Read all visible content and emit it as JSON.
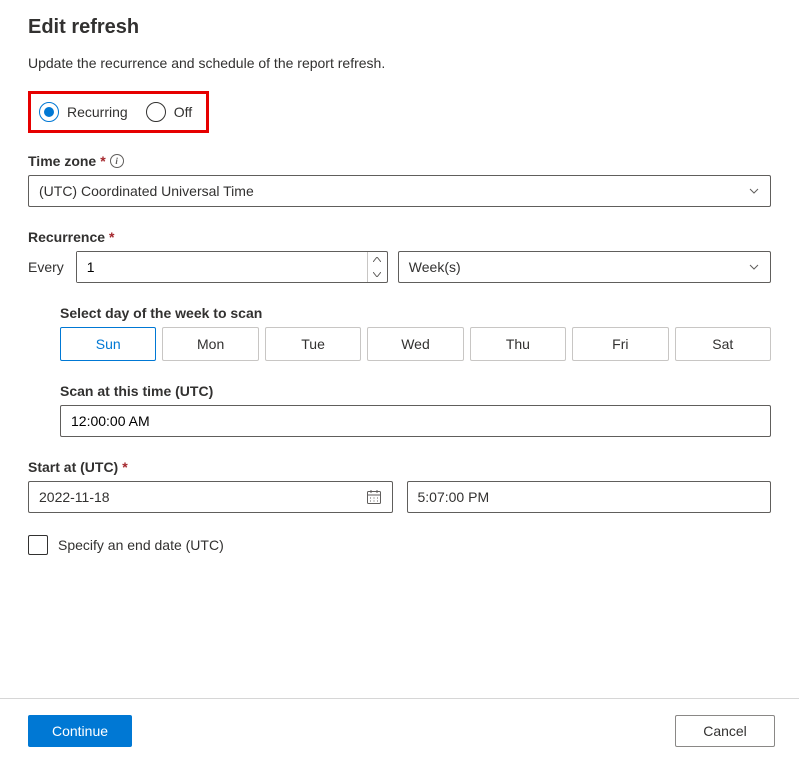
{
  "title": "Edit refresh",
  "subtitle": "Update the recurrence and schedule of the report refresh.",
  "radios": {
    "recurring": "Recurring",
    "off": "Off"
  },
  "timezone": {
    "label": "Time zone",
    "value": "(UTC) Coordinated Universal Time"
  },
  "recurrence": {
    "label": "Recurrence",
    "every_label": "Every",
    "every_value": "1",
    "unit": "Week(s)"
  },
  "days": {
    "label": "Select day of the week to scan",
    "items": [
      "Sun",
      "Mon",
      "Tue",
      "Wed",
      "Thu",
      "Fri",
      "Sat"
    ],
    "selected": "Sun"
  },
  "scan_time": {
    "label": "Scan at this time (UTC)",
    "value": "12:00:00 AM"
  },
  "start": {
    "label": "Start at (UTC)",
    "date": "2022-11-18",
    "time": "5:07:00 PM"
  },
  "end_date": {
    "label": "Specify an end date (UTC)"
  },
  "buttons": {
    "continue": "Continue",
    "cancel": "Cancel"
  }
}
